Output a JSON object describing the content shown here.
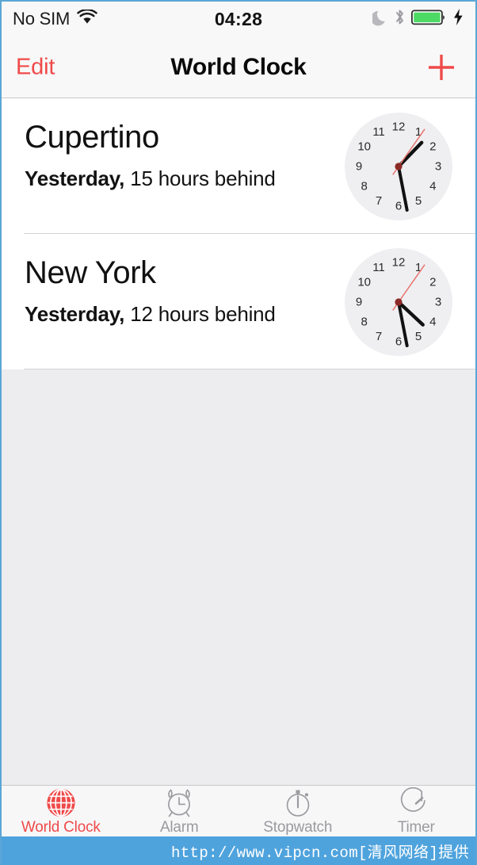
{
  "status_bar": {
    "carrier": "No SIM",
    "wifi_icon": "wifi-icon",
    "time": "04:28",
    "do_not_disturb_icon": "moon-icon",
    "bluetooth_icon": "bluetooth-icon",
    "battery_icon": "battery-full-icon",
    "charging_icon": "lightning-bolt-icon",
    "battery_level_percent": 100,
    "battery_color": "#4cd964"
  },
  "nav_bar": {
    "edit_label": "Edit",
    "title": "World Clock",
    "add_icon": "plus-icon",
    "accent_color": "#f04a4a"
  },
  "clocks": [
    {
      "city": "Cupertino",
      "relative_day": "Yesterday,",
      "offset_text": "15 hours behind",
      "clock_icon": "analog-clock-icon",
      "hour_angle": 44,
      "minute_angle": 169,
      "second_angle": 35
    },
    {
      "city": "New York",
      "relative_day": "Yesterday,",
      "offset_text": "12 hours behind",
      "clock_icon": "analog-clock-icon",
      "hour_angle": 133,
      "minute_angle": 169,
      "second_angle": 35
    }
  ],
  "clock_face_numerals": [
    "12",
    "1",
    "2",
    "3",
    "4",
    "5",
    "6",
    "7",
    "8",
    "9",
    "10",
    "11"
  ],
  "tab_bar": {
    "active_index": 0,
    "active_color": "#ef4a4a",
    "inactive_color": "#9a9a9f",
    "items": [
      {
        "label": "World Clock",
        "icon": "globe-icon"
      },
      {
        "label": "Alarm",
        "icon": "alarm-clock-icon"
      },
      {
        "label": "Stopwatch",
        "icon": "stopwatch-icon"
      },
      {
        "label": "Timer",
        "icon": "timer-icon"
      }
    ]
  },
  "watermark": {
    "text": "http://www.vipcn.com[清风网络]提供",
    "background_color": "#4fa3dd"
  }
}
